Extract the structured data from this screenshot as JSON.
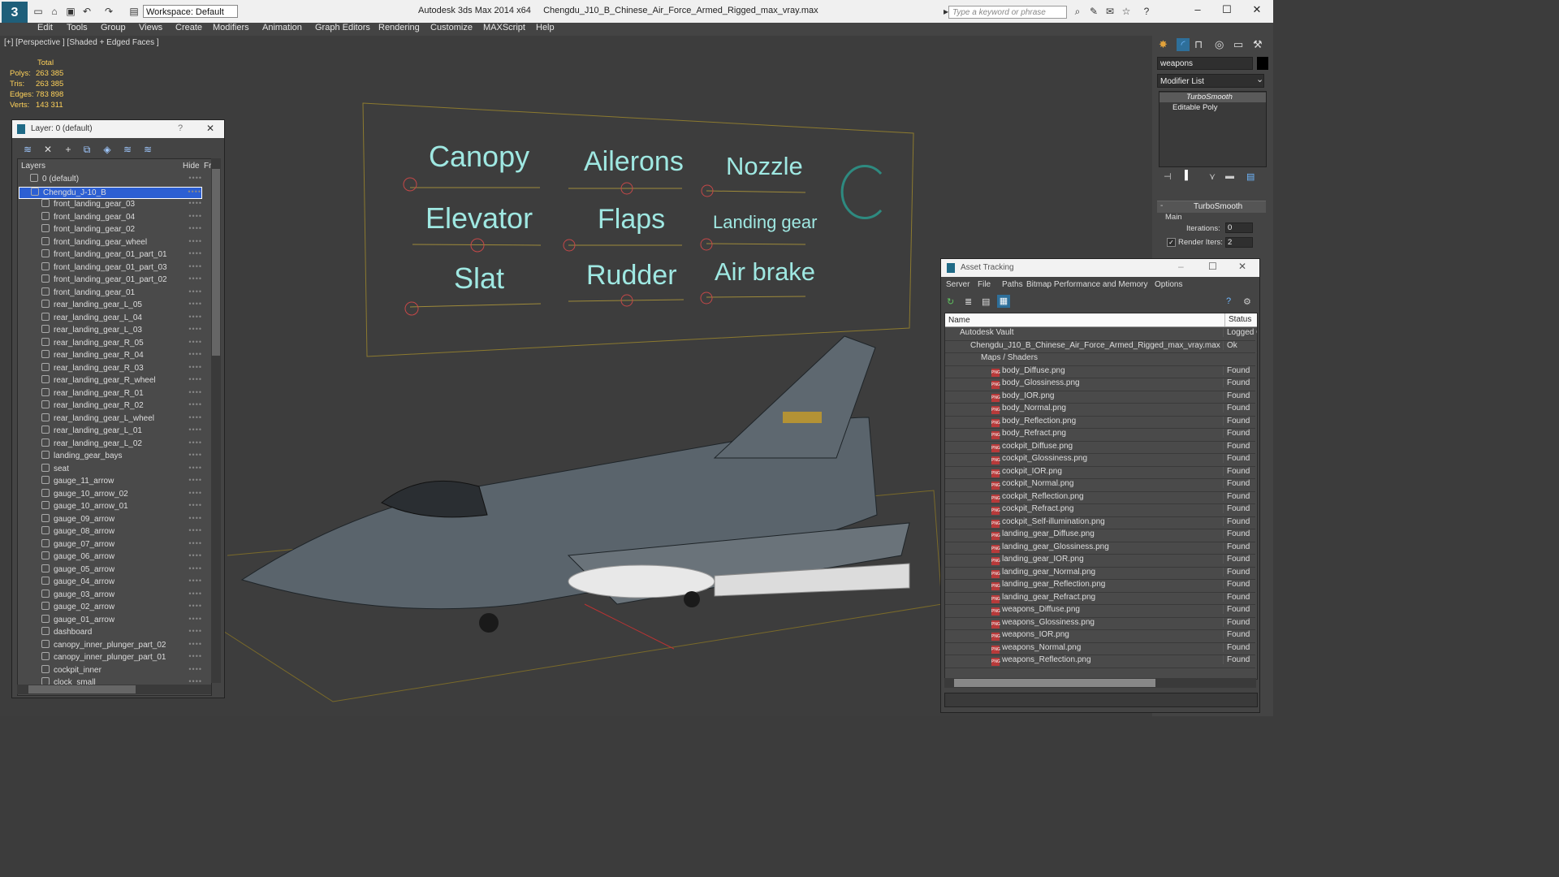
{
  "window": {
    "app_title": "Autodesk 3ds Max  2014 x64",
    "file_title": "Chengdu_J10_B_Chinese_Air_Force_Armed_Rigged_max_vray.max",
    "workspace": "Workspace: Default",
    "search_placeholder": "Type a keyword or phrase"
  },
  "menu": [
    "Edit",
    "Tools",
    "Group",
    "Views",
    "Create",
    "Modifiers",
    "Animation",
    "Graph Editors",
    "Rendering",
    "Customize",
    "MAXScript",
    "Help"
  ],
  "viewport": {
    "label": "[+] [Perspective ] [Shaded + Edged Faces ]",
    "stats": {
      "header": "Total",
      "rows": [
        {
          "k": "Polys:",
          "v": "263 385"
        },
        {
          "k": "Tris:",
          "v": "263 385"
        },
        {
          "k": "Edges:",
          "v": "783 898"
        },
        {
          "k": "Verts:",
          "v": "143 311"
        }
      ]
    },
    "board_labels": [
      "Canopy",
      "Ailerons",
      "Nozzle",
      "Elevator",
      "Flaps",
      "Landing gear",
      "Slat",
      "Rudder",
      "Air brake"
    ]
  },
  "layer_panel": {
    "title": "Layer: 0 (default)",
    "help": "?",
    "col_layers": "Layers",
    "col_hide": "Hide",
    "col_freeze": "Fr",
    "items": [
      "0 (default)",
      "Chengdu_J-10_B",
      "front_landing_gear_03",
      "front_landing_gear_04",
      "front_landing_gear_02",
      "front_landing_gear_wheel",
      "front_landing_gear_01_part_01",
      "front_landing_gear_01_part_03",
      "front_landing_gear_01_part_02",
      "front_landing_gear_01",
      "rear_landing_gear_L_05",
      "rear_landing_gear_L_04",
      "rear_landing_gear_L_03",
      "rear_landing_gear_R_05",
      "rear_landing_gear_R_04",
      "rear_landing_gear_R_03",
      "rear_landing_gear_R_wheel",
      "rear_landing_gear_R_01",
      "rear_landing_gear_R_02",
      "rear_landing_gear_L_wheel",
      "rear_landing_gear_L_01",
      "rear_landing_gear_L_02",
      "landing_gear_bays",
      "seat",
      "gauge_11_arrow",
      "gauge_10_arrow_02",
      "gauge_10_arrow_01",
      "gauge_09_arrow",
      "gauge_08_arrow",
      "gauge_07_arrow",
      "gauge_06_arrow",
      "gauge_05_arrow",
      "gauge_04_arrow",
      "gauge_03_arrow",
      "gauge_02_arrow",
      "gauge_01_arrow",
      "dashboard",
      "canopy_inner_plunger_part_02",
      "canopy_inner_plunger_part_01",
      "cockpit_inner",
      "clock_small"
    ]
  },
  "command_panel": {
    "object_name": "weapons",
    "modifier_list": "Modifier List",
    "stack": [
      "TurboSmooth",
      "Editable Poly"
    ],
    "rollout_title": "TurboSmooth",
    "group_main": "Main",
    "iterations_label": "Iterations:",
    "iterations_value": "0",
    "render_iters_label": "Render Iters:",
    "render_iters_value": "2"
  },
  "asset_tracking": {
    "title": "Asset Tracking",
    "menu": [
      "Server",
      "File",
      "Paths",
      "Bitmap Performance and Memory",
      "Options"
    ],
    "col_name": "Name",
    "col_status": "Status",
    "rows": [
      {
        "name": "Autodesk Vault",
        "status": "Logged O",
        "indent": 0
      },
      {
        "name": "Chengdu_J10_B_Chinese_Air_Force_Armed_Rigged_max_vray.max",
        "status": "Ok",
        "indent": 1
      },
      {
        "name": "Maps / Shaders",
        "status": "",
        "indent": 2
      },
      {
        "name": "body_Diffuse.png",
        "status": "Found",
        "indent": 3
      },
      {
        "name": "body_Glossiness.png",
        "status": "Found",
        "indent": 3
      },
      {
        "name": "body_IOR.png",
        "status": "Found",
        "indent": 3
      },
      {
        "name": "body_Normal.png",
        "status": "Found",
        "indent": 3
      },
      {
        "name": "body_Reflection.png",
        "status": "Found",
        "indent": 3
      },
      {
        "name": "body_Refract.png",
        "status": "Found",
        "indent": 3
      },
      {
        "name": "cockpit_Diffuse.png",
        "status": "Found",
        "indent": 3
      },
      {
        "name": "cockpit_Glossiness.png",
        "status": "Found",
        "indent": 3
      },
      {
        "name": "cockpit_IOR.png",
        "status": "Found",
        "indent": 3
      },
      {
        "name": "cockpit_Normal.png",
        "status": "Found",
        "indent": 3
      },
      {
        "name": "cockpit_Reflection.png",
        "status": "Found",
        "indent": 3
      },
      {
        "name": "cockpit_Refract.png",
        "status": "Found",
        "indent": 3
      },
      {
        "name": "cockpit_Self-illumination.png",
        "status": "Found",
        "indent": 3
      },
      {
        "name": "landing_gear_Diffuse.png",
        "status": "Found",
        "indent": 3
      },
      {
        "name": "landing_gear_Glossiness.png",
        "status": "Found",
        "indent": 3
      },
      {
        "name": "landing_gear_IOR.png",
        "status": "Found",
        "indent": 3
      },
      {
        "name": "landing_gear_Normal.png",
        "status": "Found",
        "indent": 3
      },
      {
        "name": "landing_gear_Reflection.png",
        "status": "Found",
        "indent": 3
      },
      {
        "name": "landing_gear_Refract.png",
        "status": "Found",
        "indent": 3
      },
      {
        "name": "weapons_Diffuse.png",
        "status": "Found",
        "indent": 3
      },
      {
        "name": "weapons_Glossiness.png",
        "status": "Found",
        "indent": 3
      },
      {
        "name": "weapons_IOR.png",
        "status": "Found",
        "indent": 3
      },
      {
        "name": "weapons_Normal.png",
        "status": "Found",
        "indent": 3
      },
      {
        "name": "weapons_Reflection.png",
        "status": "Found",
        "indent": 3
      }
    ]
  }
}
